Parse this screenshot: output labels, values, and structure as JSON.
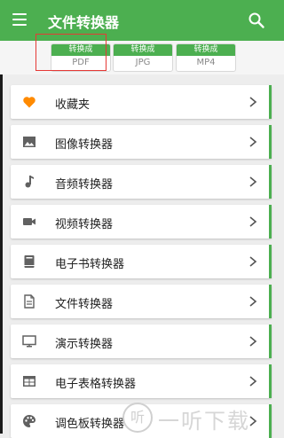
{
  "app": {
    "title": "文件转换器"
  },
  "chips": [
    {
      "top": "转换成",
      "bottom": "PDF"
    },
    {
      "top": "转换成",
      "bottom": "JPG"
    },
    {
      "top": "转换成",
      "bottom": "MP4"
    }
  ],
  "items": [
    {
      "label": "收藏夹",
      "icon": "heart-icon"
    },
    {
      "label": "图像转换器",
      "icon": "image-icon"
    },
    {
      "label": "音频转换器",
      "icon": "music-note-icon"
    },
    {
      "label": "视频转换器",
      "icon": "video-camera-icon"
    },
    {
      "label": "电子书转换器",
      "icon": "book-icon"
    },
    {
      "label": "文件转换器",
      "icon": "document-icon"
    },
    {
      "label": "演示转换器",
      "icon": "monitor-icon"
    },
    {
      "label": "电子表格转换器",
      "icon": "table-icon"
    },
    {
      "label": "调色板转换器",
      "icon": "palette-icon"
    }
  ],
  "watermark": {
    "text": "一听下载"
  },
  "colors": {
    "primary": "#4caf50",
    "heart": "#ff8a00",
    "highlight": "#e53935"
  }
}
